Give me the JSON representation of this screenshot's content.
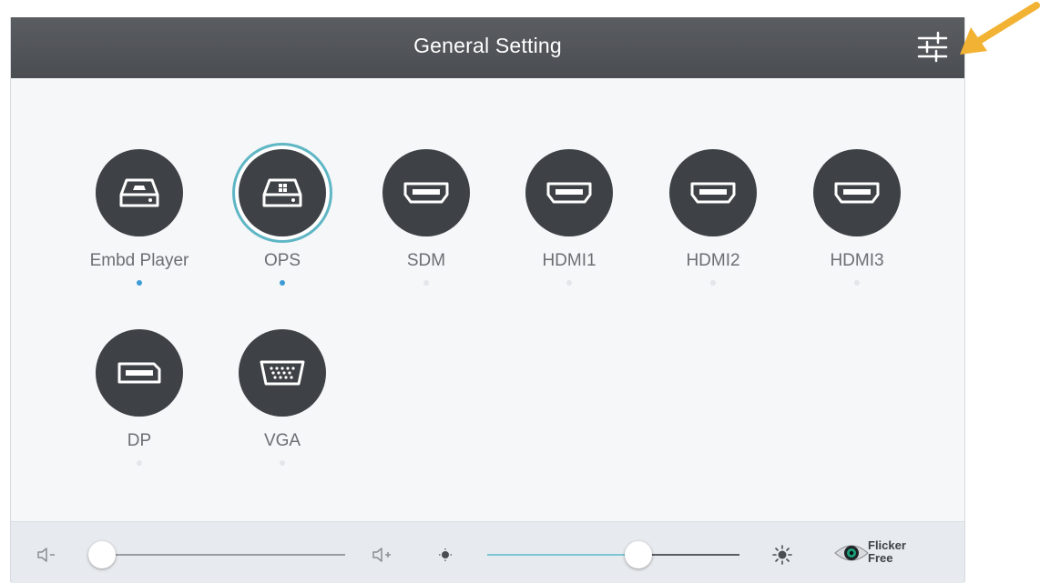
{
  "header": {
    "title": "General Setting"
  },
  "sources": [
    {
      "label": "Embd Player",
      "icon": "storage-drive-icon",
      "selected": false,
      "signal": true
    },
    {
      "label": "OPS",
      "icon": "ops-drive-icon",
      "selected": true,
      "signal": true
    },
    {
      "label": "SDM",
      "icon": "hdmi-port-icon",
      "selected": false,
      "signal": false
    },
    {
      "label": "HDMI1",
      "icon": "hdmi-port-icon",
      "selected": false,
      "signal": false
    },
    {
      "label": "HDMI2",
      "icon": "hdmi-port-icon",
      "selected": false,
      "signal": false
    },
    {
      "label": "HDMI3",
      "icon": "hdmi-port-icon",
      "selected": false,
      "signal": false
    },
    {
      "label": "DP",
      "icon": "displayport-icon",
      "selected": false,
      "signal": false
    },
    {
      "label": "VGA",
      "icon": "vga-port-icon",
      "selected": false,
      "signal": false
    }
  ],
  "controls": {
    "volume_level": 0.0,
    "brightness_level": 0.6,
    "flicker_free": {
      "line1": "Flicker",
      "line2": "Free"
    }
  },
  "colors": {
    "active_signal": "#3d9bd6",
    "inactive_signal": "#e3e6ea",
    "selected_ring": "#5fb6c4",
    "annotation_arrow": "#f2b233"
  }
}
